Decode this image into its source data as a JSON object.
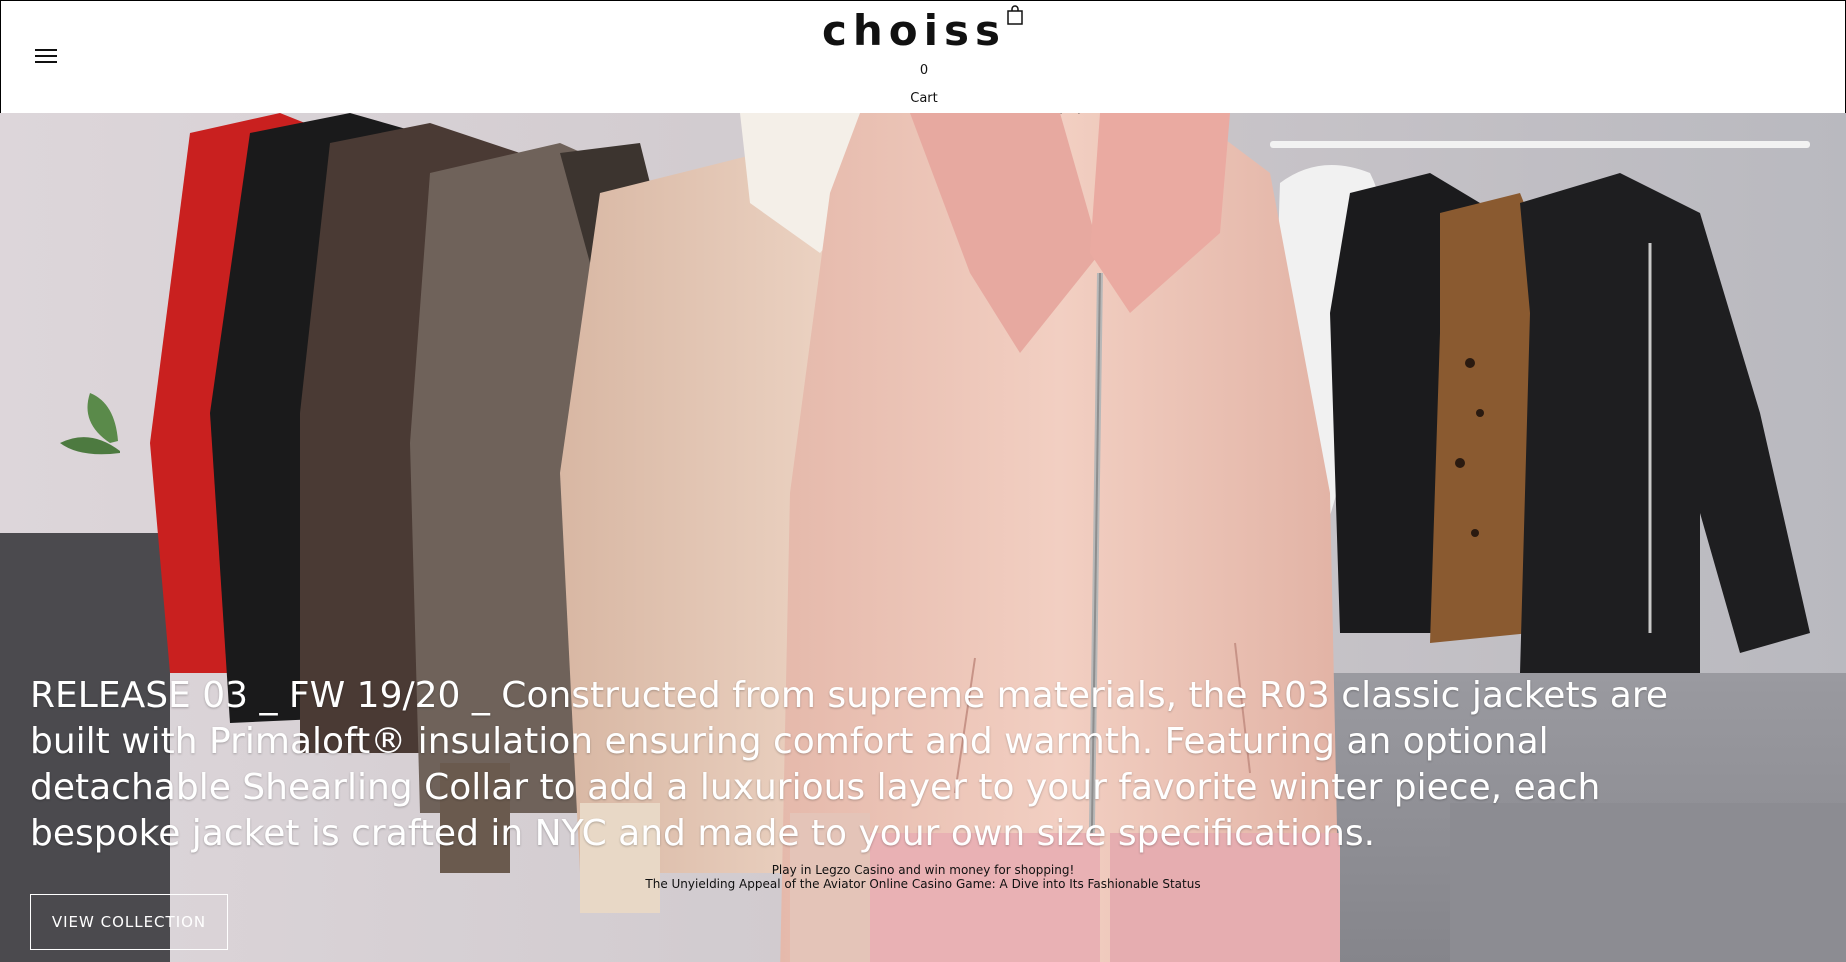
{
  "header": {
    "logo": "choiss",
    "menu_icon": "hamburger-menu-icon",
    "cart_icon": "shopping-bag-icon",
    "cart_count": "0",
    "cart_label": "Cart"
  },
  "hero": {
    "image_description_icon": "hero-jackets-photo",
    "headline": "RELEASE 03 _ FW 19/20 _ Constructed from supreme materials, the R03 classic jackets are built with Primaloft® insulation ensuring comfort and warmth. Featuring an optional detachable Shearling Collar to add a luxurious layer to your favorite winter piece, each bespoke jacket is crafted in NYC and made to your own size specifications.",
    "promo_line_1": "Play in Legzo Casino and win money for shopping!",
    "promo_line_2": "The Unyielding Appeal of the Aviator Online Casino Game: A Dive into Its Fashionable Status",
    "cta_label": "VIEW COLLECTION"
  },
  "colors": {
    "header_bg": "#ffffff",
    "text_dark": "#111111",
    "hero_text": "#ffffff",
    "jacket_pink": "#efc6b8",
    "jacket_red": "#c9201f"
  }
}
